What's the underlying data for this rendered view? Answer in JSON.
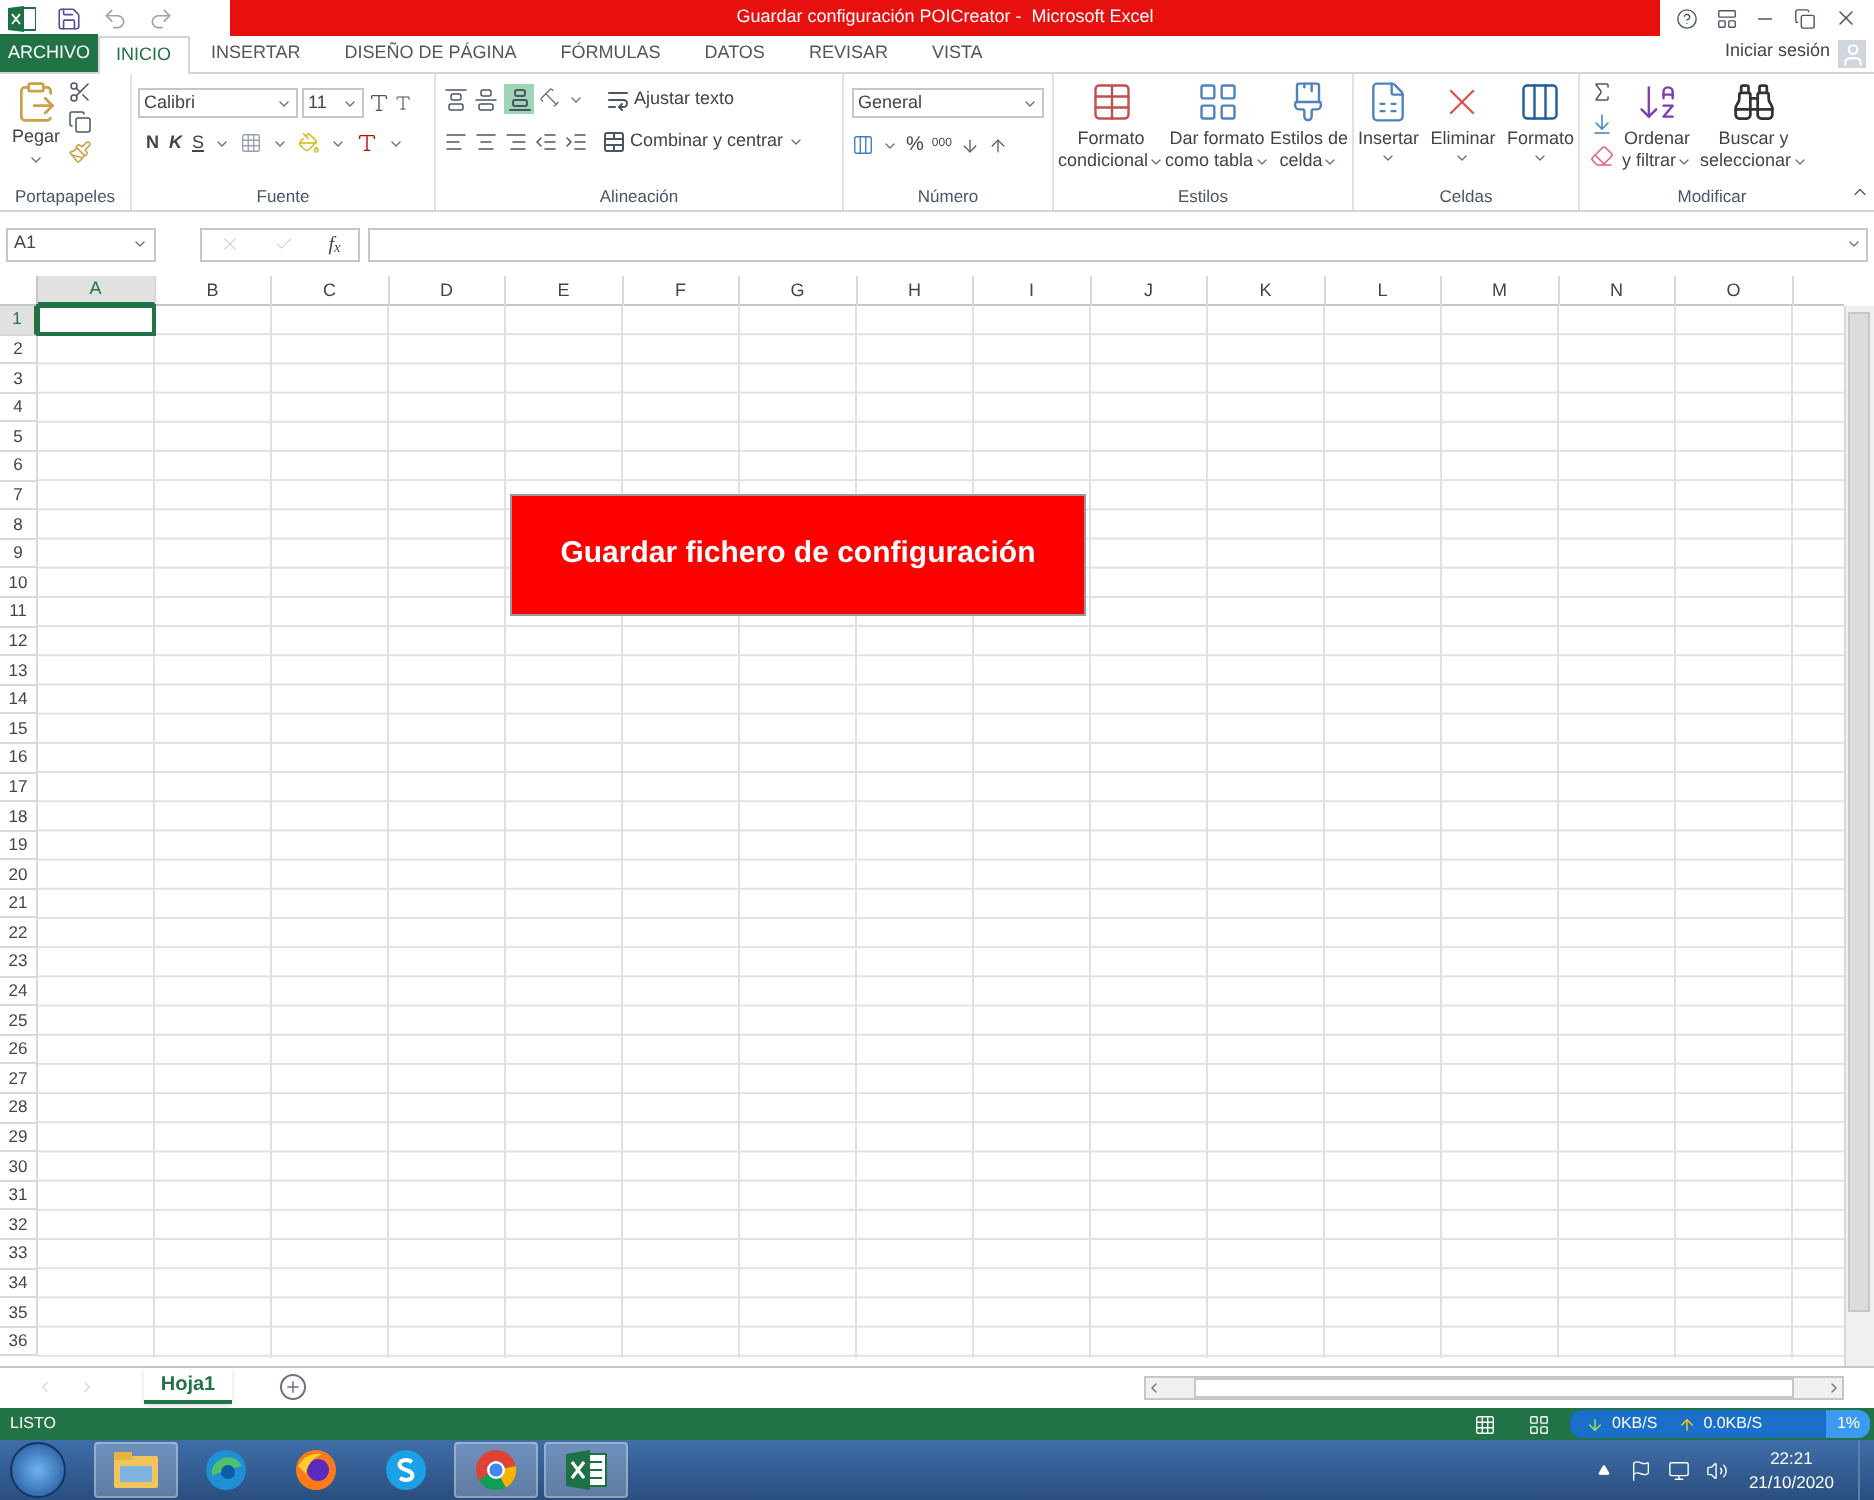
{
  "window": {
    "title": "Guardar configuración POICreator -  Microsoft Excel"
  },
  "ribbon_tabs": [
    {
      "label": "ARCHIVO",
      "kind": "file",
      "selected": false
    },
    {
      "label": "INICIO",
      "kind": "tab",
      "selected": true
    },
    {
      "label": "INSERTAR",
      "kind": "tab",
      "selected": false
    },
    {
      "label": "DISEÑO DE PÁGINA",
      "kind": "tab",
      "selected": false
    },
    {
      "label": "FÓRMULAS",
      "kind": "tab",
      "selected": false
    },
    {
      "label": "DATOS",
      "kind": "tab",
      "selected": false
    },
    {
      "label": "REVISAR",
      "kind": "tab",
      "selected": false
    },
    {
      "label": "VISTA",
      "kind": "tab",
      "selected": false
    }
  ],
  "sign_in": "Iniciar sesión",
  "clipboard": {
    "label": "Portapapeles",
    "paste": "Pegar"
  },
  "font": {
    "label": "Fuente",
    "font_name": "Calibri",
    "font_size": "11",
    "bold": "N",
    "italic": "K",
    "underline": "S"
  },
  "alignment": {
    "label": "Alineación",
    "wrap_text": "Ajustar texto",
    "merge": "Combinar y centrar",
    "bottom_align_on": true
  },
  "number": {
    "label": "Número",
    "format": "General",
    "percent": "%",
    "thousands": "000"
  },
  "styles": {
    "label": "Estilos",
    "buttons": [
      {
        "line1": "Formato",
        "line2": "condicional"
      },
      {
        "line1": "Dar formato",
        "line2": "como tabla"
      },
      {
        "line1": "Estilos de",
        "line2": "celda"
      }
    ]
  },
  "cells": {
    "label": "Celdas",
    "buttons": [
      "Insertar",
      "Eliminar",
      "Formato"
    ]
  },
  "editing": {
    "label": "Modificar",
    "buttons": [
      {
        "line1": "Ordenar",
        "line2": "y filtrar"
      },
      {
        "line1": "Buscar y",
        "line2": "seleccionar"
      }
    ]
  },
  "formula_bar": {
    "name_box": "A1",
    "function_label": "f$_{x}$"
  },
  "columns": [
    {
      "label": "A",
      "selected": true
    },
    {
      "label": "B",
      "selected": false
    },
    {
      "label": "C",
      "selected": false
    },
    {
      "label": "D",
      "selected": false
    },
    {
      "label": "E",
      "selected": false
    },
    {
      "label": "F",
      "selected": false
    },
    {
      "label": "G",
      "selected": false
    },
    {
      "label": "H",
      "selected": false
    },
    {
      "label": "I",
      "selected": false
    },
    {
      "label": "J",
      "selected": false
    },
    {
      "label": "K",
      "selected": false
    },
    {
      "label": "L",
      "selected": false
    },
    {
      "label": "M",
      "selected": false
    },
    {
      "label": "N",
      "selected": false
    },
    {
      "label": "O",
      "selected": false
    }
  ],
  "rows": [
    {
      "label": "1",
      "selected": true
    },
    {
      "label": "2",
      "selected": false
    },
    {
      "label": "3",
      "selected": false
    },
    {
      "label": "4",
      "selected": false
    },
    {
      "label": "5",
      "selected": false
    },
    {
      "label": "6",
      "selected": false
    },
    {
      "label": "7",
      "selected": false
    },
    {
      "label": "8",
      "selected": false
    },
    {
      "label": "9",
      "selected": false
    },
    {
      "label": "10",
      "selected": false
    },
    {
      "label": "11",
      "selected": false
    },
    {
      "label": "12",
      "selected": false
    },
    {
      "label": "13",
      "selected": false
    },
    {
      "label": "14",
      "selected": false
    },
    {
      "label": "15",
      "selected": false
    },
    {
      "label": "16",
      "selected": false
    },
    {
      "label": "17",
      "selected": false
    },
    {
      "label": "18",
      "selected": false
    },
    {
      "label": "19",
      "selected": false
    },
    {
      "label": "20",
      "selected": false
    },
    {
      "label": "21",
      "selected": false
    },
    {
      "label": "22",
      "selected": false
    },
    {
      "label": "23",
      "selected": false
    },
    {
      "label": "24",
      "selected": false
    },
    {
      "label": "25",
      "selected": false
    },
    {
      "label": "26",
      "selected": false
    },
    {
      "label": "27",
      "selected": false
    },
    {
      "label": "28",
      "selected": false
    },
    {
      "label": "29",
      "selected": false
    },
    {
      "label": "30",
      "selected": false
    },
    {
      "label": "31",
      "selected": false
    },
    {
      "label": "32",
      "selected": false
    },
    {
      "label": "33",
      "selected": false
    },
    {
      "label": "34",
      "selected": false
    },
    {
      "label": "35",
      "selected": false
    },
    {
      "label": "36",
      "selected": false
    }
  ],
  "sheet_button": {
    "label": "Guardar fichero de configuración"
  },
  "sheet_tabs": [
    {
      "label": "Hoja1",
      "selected": true
    }
  ],
  "status_bar": {
    "status": "LISTO",
    "download": "0KB/S",
    "upload": "0.0KB/S",
    "cpu": "1%"
  },
  "taskbar": {
    "apps": [
      {
        "kind": "explorer",
        "running": true
      },
      {
        "kind": "edge",
        "running": false
      },
      {
        "kind": "firefox",
        "running": false
      },
      {
        "kind": "skype",
        "running": false
      },
      {
        "kind": "chrome",
        "running": true
      },
      {
        "kind": "excel",
        "running": true
      }
    ],
    "time": "22:21",
    "date": "21/10/2020"
  }
}
